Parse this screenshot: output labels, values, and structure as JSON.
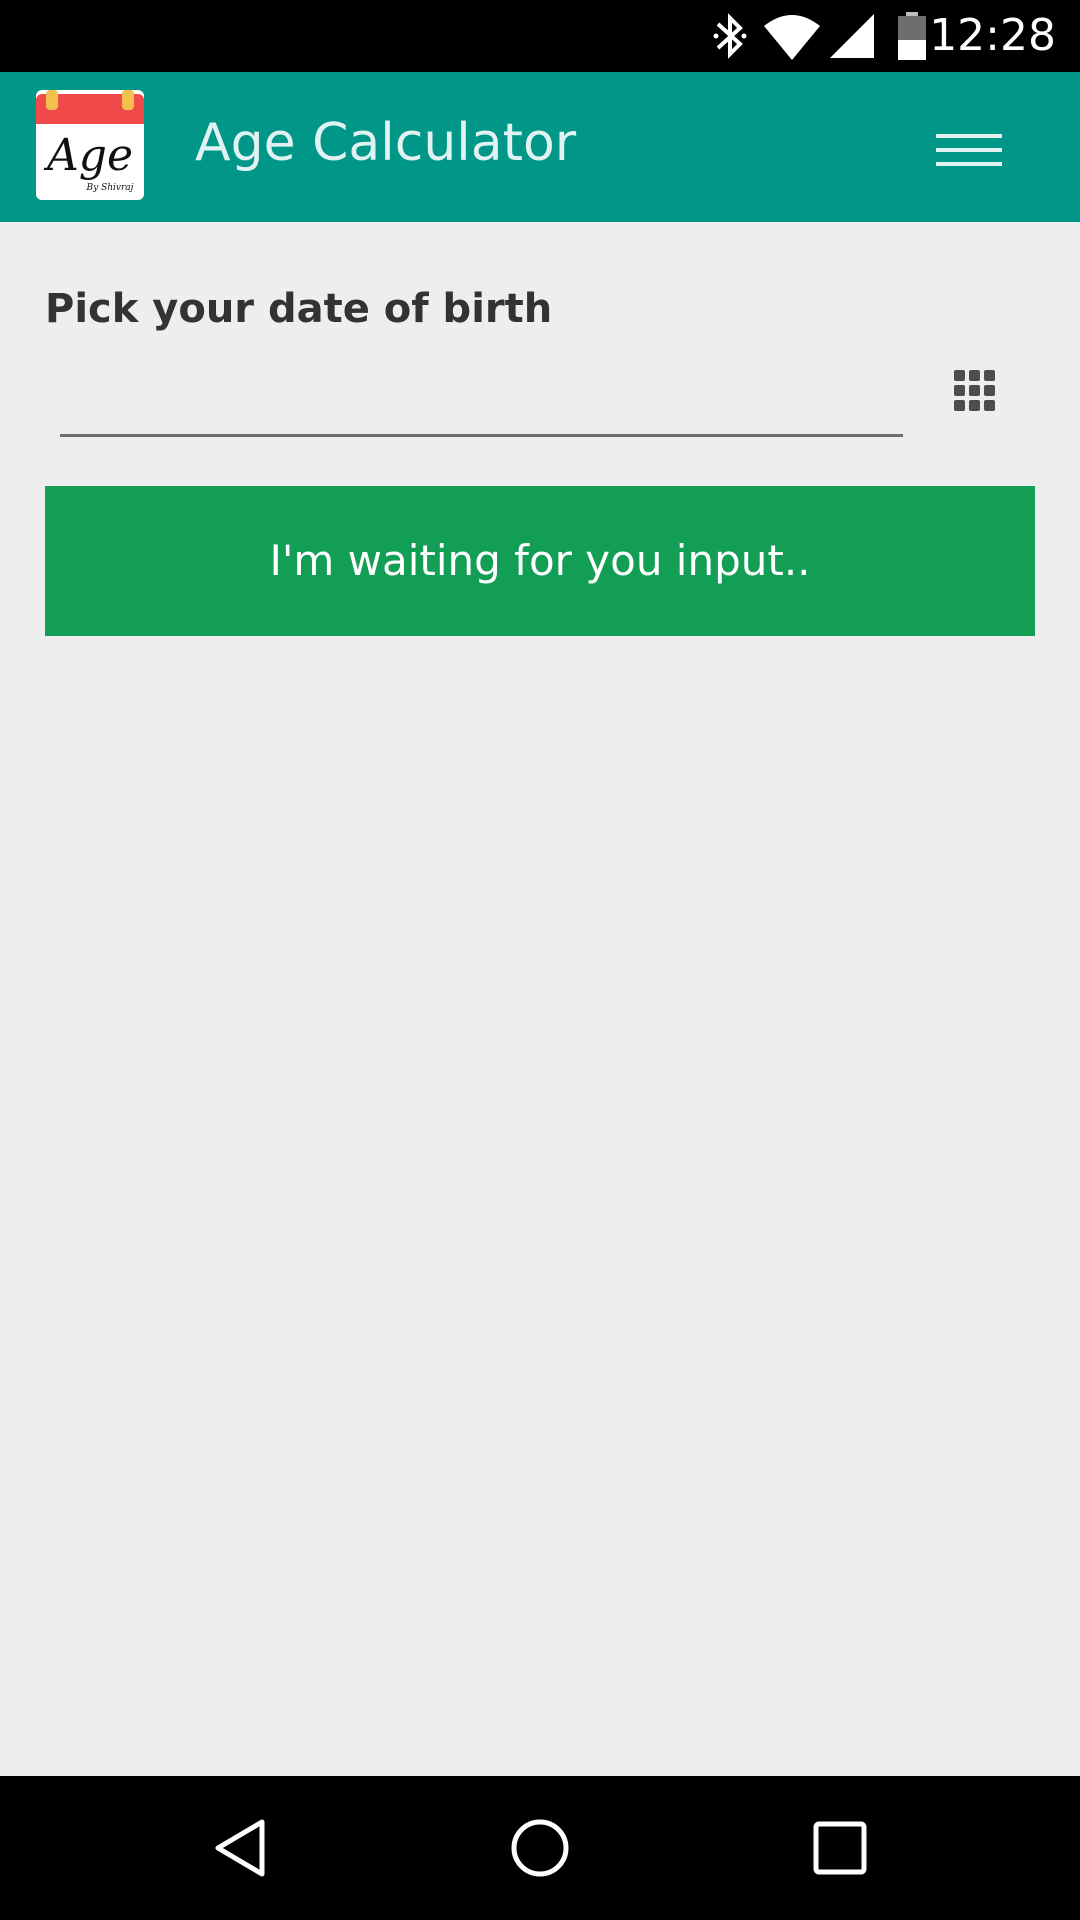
{
  "status_bar": {
    "time": "12:28",
    "icons": [
      "bluetooth-icon",
      "wifi-icon",
      "cell-signal-icon",
      "battery-icon"
    ]
  },
  "app_bar": {
    "title": "Age Calculator",
    "logo_text": "Age",
    "logo_subtext": "By Shivraj",
    "menu_icon": "hamburger-menu-icon",
    "color": "#009688"
  },
  "form": {
    "label": "Pick your date of birth",
    "dob_value": "",
    "calendar_icon": "grid-calendar-icon"
  },
  "result": {
    "text": "I'm waiting for you input..",
    "color": "#139e55"
  },
  "nav_bar": {
    "buttons": [
      "back-icon",
      "home-icon",
      "recents-icon"
    ]
  }
}
